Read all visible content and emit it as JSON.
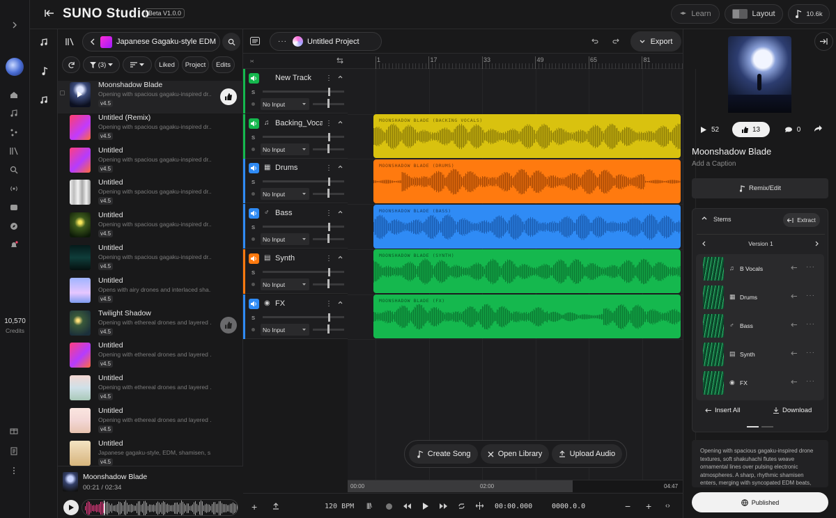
{
  "app": {
    "title": "SUNO Studio",
    "beta": "Beta V1.0.0",
    "learn": "Learn",
    "layout": "Layout",
    "credits_short": "10.6k"
  },
  "sidebar": {
    "credits": "10,570",
    "credits_label": "Credits"
  },
  "library": {
    "playlist": "Japanese Gagaku-style EDM",
    "filter_label": "(3)",
    "chips": [
      "Liked",
      "Project",
      "Edits"
    ],
    "songs": [
      {
        "title": "Moonshadow Blade",
        "desc": "Opening with spacious gagaku-inspired dr...",
        "ver": "v4.5"
      },
      {
        "title": "Untitled (Remix)",
        "desc": "Opening with spacious gagaku-inspired dr...",
        "ver": "v4.5"
      },
      {
        "title": "Untitled",
        "desc": "Opening with spacious gagaku-inspired dr...",
        "ver": "v4.5"
      },
      {
        "title": "Untitled",
        "desc": "Opening with spacious gagaku-inspired dr...",
        "ver": "v4.5"
      },
      {
        "title": "Untitled",
        "desc": "Opening with spacious gagaku-inspired dr...",
        "ver": "v4.5"
      },
      {
        "title": "Untitled",
        "desc": "Opening with spacious gagaku-inspired dr...",
        "ver": "v4.5"
      },
      {
        "title": "Untitled",
        "desc": "Opens with airy drones and interlaced sha...",
        "ver": "v4.5"
      },
      {
        "title": "Twilight Shadow",
        "desc": "Opening with ethereal drones and layered ...",
        "ver": "v4.5"
      },
      {
        "title": "Untitled",
        "desc": "Opening with ethereal drones and layered ...",
        "ver": "v4.5"
      },
      {
        "title": "Untitled",
        "desc": "Opening with ethereal drones and layered ...",
        "ver": "v4.5"
      },
      {
        "title": "Untitled",
        "desc": "Opening with ethereal drones and layered ...",
        "ver": "v4.5"
      },
      {
        "title": "Untitled",
        "desc": "Japanese gagaku-style, EDM, shamisen, s...",
        "ver": "v4.5"
      }
    ],
    "now_playing": {
      "title": "Moonshadow Blade",
      "time": "00:21 / 02:34"
    }
  },
  "project": {
    "name": "Untitled Project",
    "export": "Export"
  },
  "ruler": [
    "1",
    "17",
    "33",
    "49",
    "65",
    "81"
  ],
  "tracks": [
    {
      "name": "New Track",
      "input": "No Input",
      "clip": ""
    },
    {
      "name": "Backing_Vocals",
      "input": "No Input",
      "clip": "MOONSHADOW BLADE (BACKING VOCALS)"
    },
    {
      "name": "Drums",
      "input": "No Input",
      "clip": "MOONSHADOW BLADE (DRUMS)"
    },
    {
      "name": "Bass",
      "input": "No Input",
      "clip": "MOONSHADOW BLADE (BASS)"
    },
    {
      "name": "Synth",
      "input": "No Input",
      "clip": "MOONSHADOW BLADE (SYNTH)"
    },
    {
      "name": "FX",
      "input": "No Input",
      "clip": "MOONSHADOW BLADE (FX)"
    }
  ],
  "track_s_label": "S",
  "floating": {
    "create": "Create Song",
    "open": "Open Library",
    "upload": "Upload Audio"
  },
  "transport": {
    "start": "00:00",
    "mid": "02:00",
    "end": "04:47",
    "bpm": "120 BPM",
    "time": "00:00.000",
    "pos": "0000.0.0"
  },
  "colors": {
    "vocals": "#d9c20f",
    "drums": "#ff7a0f",
    "bass": "#2f8bf5",
    "synth": "#15b84e",
    "fx": "#15b84e"
  },
  "details": {
    "likes": "52",
    "thumbs": "13",
    "comments": "0",
    "title": "Moonshadow Blade",
    "caption": "Add a Caption",
    "remix": "Remix/Edit",
    "stems_label": "Stems",
    "extract": "Extract",
    "version": "Version 1",
    "stems": [
      "B Vocals",
      "Drums",
      "Bass",
      "Synth",
      "FX"
    ],
    "insert_all": "Insert All",
    "download": "Download",
    "description": "Opening with spacious gagaku-inspired drone textures, soft shakuhachi flutes weave ornamental lines over pulsing electronic atmospheres. A sharp, rhythmic shamisen enters, merging with syncopated EDM beats,",
    "published": "Published"
  }
}
